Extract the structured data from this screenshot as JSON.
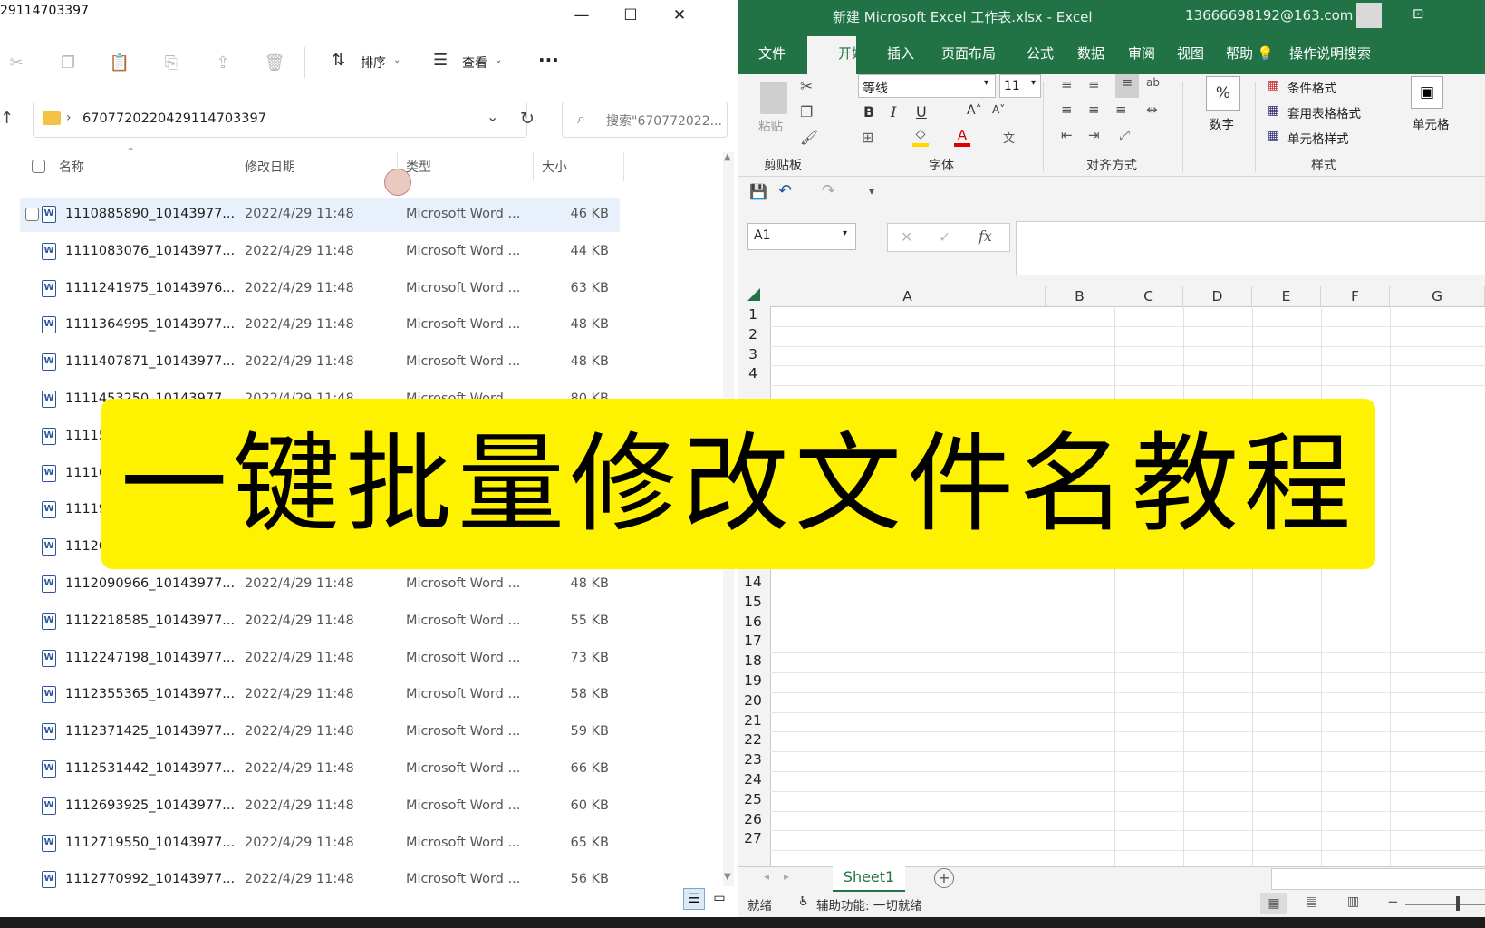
{
  "explorer": {
    "title": "29114703397",
    "toolbar": {
      "sort_label": "排序",
      "view_label": "查看",
      "more_label": "···"
    },
    "address": {
      "path": "670772022042911470339​7"
    },
    "search": {
      "placeholder": "搜索\"670772022..."
    },
    "columns": {
      "name": "名称",
      "date": "修改日期",
      "type": "类型",
      "size": "大小"
    },
    "rows": [
      {
        "name": "1110885890_10143977...",
        "date": "2022/4/29 11:48",
        "type": "Microsoft Word ...",
        "size": "46 KB"
      },
      {
        "name": "1111083076_10143977...",
        "date": "2022/4/29 11:48",
        "type": "Microsoft Word ...",
        "size": "44 KB"
      },
      {
        "name": "1111241975_10143976...",
        "date": "2022/4/29 11:48",
        "type": "Microsoft Word ...",
        "size": "63 KB"
      },
      {
        "name": "1111364995_10143977...",
        "date": "2022/4/29 11:48",
        "type": "Microsoft Word ...",
        "size": "48 KB"
      },
      {
        "name": "1111407871_10143977...",
        "date": "2022/4/29 11:48",
        "type": "Microsoft Word ...",
        "size": "48 KB"
      },
      {
        "name": "1111453250_10143977...",
        "date": "2022/4/29 11:48",
        "type": "Microsoft Word ...",
        "size": "80 KB"
      },
      {
        "name": "11115",
        "date": "",
        "type": "",
        "size": ""
      },
      {
        "name": "11116",
        "date": "",
        "type": "",
        "size": ""
      },
      {
        "name": "11119",
        "date": "",
        "type": "",
        "size": ""
      },
      {
        "name": "11120",
        "date": "",
        "type": "",
        "size": ""
      },
      {
        "name": "1112090966_10143977...",
        "date": "2022/4/29 11:48",
        "type": "Microsoft Word ...",
        "size": "48 KB"
      },
      {
        "name": "1112218585_10143977...",
        "date": "2022/4/29 11:48",
        "type": "Microsoft Word ...",
        "size": "55 KB"
      },
      {
        "name": "1112247198_10143977...",
        "date": "2022/4/29 11:48",
        "type": "Microsoft Word ...",
        "size": "73 KB"
      },
      {
        "name": "1112355365_10143977...",
        "date": "2022/4/29 11:48",
        "type": "Microsoft Word ...",
        "size": "58 KB"
      },
      {
        "name": "1112371425_10143977...",
        "date": "2022/4/29 11:48",
        "type": "Microsoft Word ...",
        "size": "59 KB"
      },
      {
        "name": "1112531442_10143977...",
        "date": "2022/4/29 11:48",
        "type": "Microsoft Word ...",
        "size": "66 KB"
      },
      {
        "name": "1112693925_10143977...",
        "date": "2022/4/29 11:48",
        "type": "Microsoft Word ...",
        "size": "60 KB"
      },
      {
        "name": "1112719550_10143977...",
        "date": "2022/4/29 11:48",
        "type": "Microsoft Word ...",
        "size": "65 KB"
      },
      {
        "name": "1112770992_10143977...",
        "date": "2022/4/29 11:48",
        "type": "Microsoft Word ...",
        "size": "56 KB"
      }
    ]
  },
  "excel": {
    "title": "新建 Microsoft Excel 工作表.xlsx  -  Excel",
    "user": "13666698192@163.com",
    "menu": [
      "文件",
      "开始",
      "插入",
      "页面布局",
      "公式",
      "数据",
      "审阅",
      "视图",
      "帮助"
    ],
    "tell_me": "操作说明搜索",
    "ribbon": {
      "paste": "粘贴",
      "font_name": "等线",
      "font_size": "11",
      "number_label": "数字",
      "cond_format": "条件格式",
      "table_format": "套用表格格式",
      "cell_style": "单元格样式",
      "cells_label": "单元格",
      "groups": {
        "clipboard": "剪贴板",
        "font": "字体",
        "align": "对齐方式",
        "styles": "样式"
      }
    },
    "name_box": "A1",
    "fx": "fx",
    "columns": [
      "A",
      "B",
      "C",
      "D",
      "E",
      "F",
      "G"
    ],
    "rows_top": [
      "1",
      "2",
      "3",
      "4"
    ],
    "rows_bottom": [
      "14",
      "15",
      "16",
      "17",
      "18",
      "19",
      "20",
      "21",
      "22",
      "23",
      "24",
      "25",
      "26",
      "27"
    ],
    "sheet_tab": "Sheet1",
    "status": {
      "ready": "就绪",
      "accessibility": "辅助功能: 一切就绪"
    }
  },
  "banner": {
    "text": "一键批量修改文件名教程"
  },
  "colors": {
    "excel_green": "#217346",
    "banner_yellow": "#fef200",
    "selection_blue": "#e8f1fb"
  }
}
